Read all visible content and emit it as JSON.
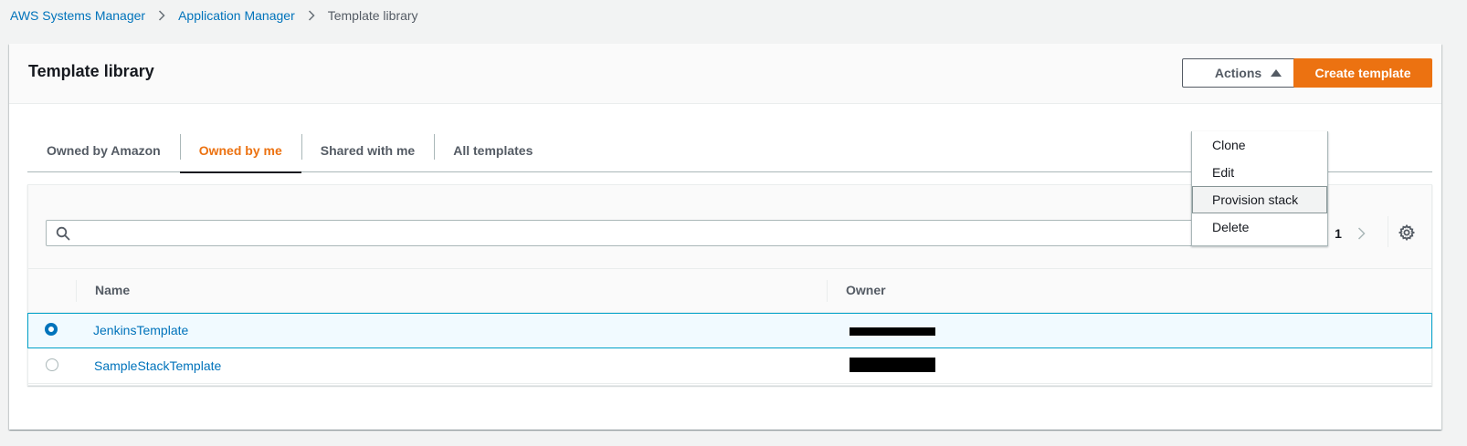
{
  "breadcrumb": {
    "items": [
      {
        "label": "AWS Systems Manager"
      },
      {
        "label": "Application Manager"
      },
      {
        "label": "Template library"
      }
    ]
  },
  "header": {
    "title": "Template library",
    "actions_label": "Actions",
    "create_label": "Create template"
  },
  "actions_menu": {
    "items": [
      {
        "label": "Clone"
      },
      {
        "label": "Edit"
      },
      {
        "label": "Provision stack",
        "highlighted": true
      },
      {
        "label": "Delete"
      }
    ]
  },
  "tabs": [
    {
      "label": "Owned by Amazon",
      "active": false
    },
    {
      "label": "Owned by me",
      "active": true
    },
    {
      "label": "Shared with me",
      "active": false
    },
    {
      "label": "All templates",
      "active": false
    }
  ],
  "table": {
    "search": {
      "value": "",
      "placeholder": ""
    },
    "pagination": {
      "current_page": "1"
    },
    "columns": [
      {
        "label": "Name"
      },
      {
        "label": "Owner"
      }
    ],
    "rows": [
      {
        "name": "JenkinsTemplate",
        "owner": "[redacted]",
        "selected": true
      },
      {
        "name": "SampleStackTemplate",
        "owner": "[redacted]",
        "selected": false
      }
    ]
  },
  "colors": {
    "accent_orange": "#ec7211",
    "link_blue": "#0073bb",
    "selected_border": "#00a1c9",
    "selected_bg": "#f1faff"
  },
  "icons": [
    "chevron-right-icon",
    "triangle-up-icon",
    "search-icon",
    "chevron-left-icon",
    "gear-icon"
  ]
}
